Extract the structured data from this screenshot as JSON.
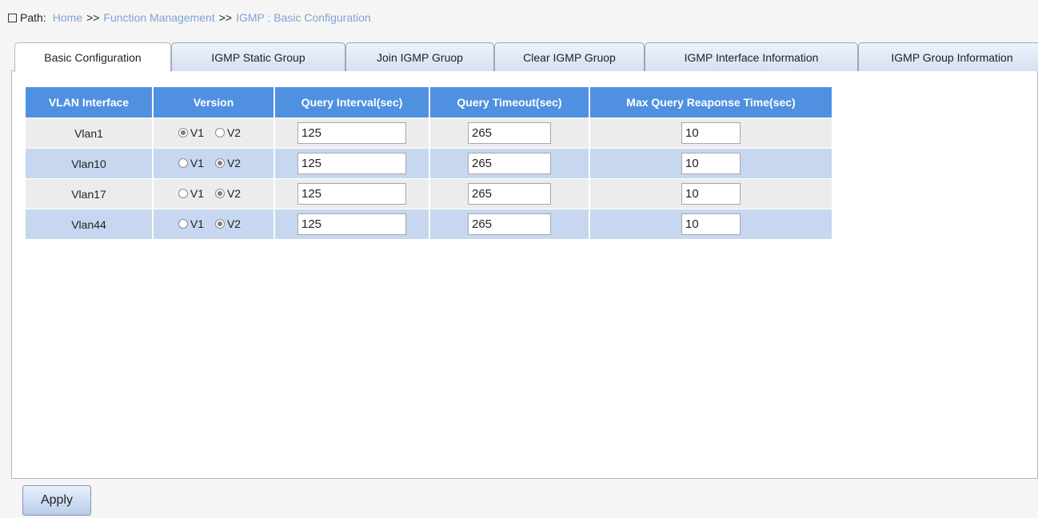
{
  "path": {
    "label": "Path:",
    "home": "Home",
    "sep1": ">>",
    "function_mgmt": "Function Management",
    "sep2": ">>",
    "current": "IGMP : Basic Configuration"
  },
  "tabs": [
    {
      "label": "Basic Configuration",
      "active": true
    },
    {
      "label": "IGMP Static Group",
      "active": false
    },
    {
      "label": "Join IGMP Gruop",
      "active": false
    },
    {
      "label": "Clear IGMP Gruop",
      "active": false
    },
    {
      "label": "IGMP Interface Information",
      "active": false
    },
    {
      "label": "IGMP Group Information",
      "active": false
    }
  ],
  "table": {
    "headers": [
      "VLAN Interface",
      "Version",
      "Query Interval(sec)",
      "Query Timeout(sec)",
      "Max Query Reaponse Time(sec)"
    ],
    "version_options": [
      "V1",
      "V2"
    ],
    "rows": [
      {
        "vlan": "Vlan1",
        "version": "V1",
        "query_interval": "125",
        "query_timeout": "265",
        "max_response": "10"
      },
      {
        "vlan": "Vlan10",
        "version": "V2",
        "query_interval": "125",
        "query_timeout": "265",
        "max_response": "10"
      },
      {
        "vlan": "Vlan17",
        "version": "V2",
        "query_interval": "125",
        "query_timeout": "265",
        "max_response": "10"
      },
      {
        "vlan": "Vlan44",
        "version": "V2",
        "query_interval": "125",
        "query_timeout": "265",
        "max_response": "10"
      }
    ]
  },
  "apply_label": "Apply",
  "colors": {
    "header_bg": "#4f90e0",
    "row_alt": "#c7d7f0",
    "row_plain": "#ececec",
    "crumb_link": "#7ea3d4"
  }
}
